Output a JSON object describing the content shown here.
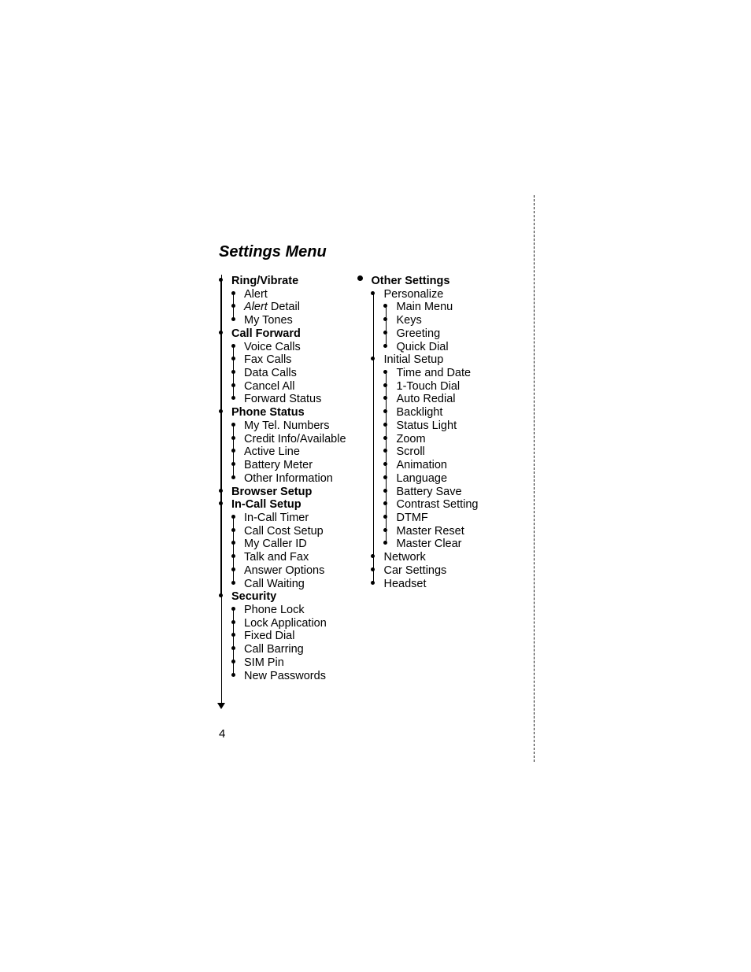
{
  "title": "Settings Menu",
  "page_number": "4",
  "col1": [
    {
      "label": "Ring/Vibrate",
      "bold": true,
      "children": [
        {
          "label": "Alert"
        },
        {
          "label_parts": [
            {
              "text": "Alert",
              "italic": true
            },
            {
              "text": " Detail"
            }
          ]
        },
        {
          "label": "My Tones"
        }
      ]
    },
    {
      "label": "Call Forward",
      "bold": true,
      "children": [
        {
          "label": "Voice Calls"
        },
        {
          "label": "Fax Calls"
        },
        {
          "label": "Data Calls"
        },
        {
          "label": "Cancel All"
        },
        {
          "label": "Forward Status"
        }
      ]
    },
    {
      "label": "Phone Status",
      "bold": true,
      "children": [
        {
          "label": "My Tel. Numbers"
        },
        {
          "label": "Credit Info/Available"
        },
        {
          "label": "Active Line"
        },
        {
          "label": "Battery Meter"
        },
        {
          "label": "Other Information"
        }
      ]
    },
    {
      "label": "Browser Setup",
      "bold": true
    },
    {
      "label": "In-Call Setup",
      "bold": true,
      "children": [
        {
          "label": "In-Call Timer"
        },
        {
          "label": "Call Cost Setup"
        },
        {
          "label": "My Caller ID"
        },
        {
          "label": "Talk and Fax"
        },
        {
          "label": "Answer Options"
        },
        {
          "label": "Call Waiting"
        }
      ]
    },
    {
      "label": "Security",
      "bold": true,
      "children": [
        {
          "label": "Phone Lock"
        },
        {
          "label": "Lock Application"
        },
        {
          "label": "Fixed Dial"
        },
        {
          "label": "Call Barring"
        },
        {
          "label": "SIM Pin"
        },
        {
          "label": "New Passwords"
        }
      ]
    }
  ],
  "col2": {
    "label": "Other Settings",
    "bold": true,
    "children": [
      {
        "label": "Personalize",
        "children": [
          {
            "label": "Main Menu"
          },
          {
            "label": "Keys"
          },
          {
            "label": "Greeting"
          },
          {
            "label": "Quick Dial"
          }
        ]
      },
      {
        "label": "Initial Setup",
        "children": [
          {
            "label": "Time and Date"
          },
          {
            "label": "1-Touch Dial"
          },
          {
            "label": "Auto Redial"
          },
          {
            "label": "Backlight"
          },
          {
            "label": "Status Light"
          },
          {
            "label": "Zoom"
          },
          {
            "label": "Scroll"
          },
          {
            "label": "Animation"
          },
          {
            "label": "Language"
          },
          {
            "label": "Battery Save"
          },
          {
            "label": "Contrast Setting"
          },
          {
            "label": "DTMF"
          },
          {
            "label": "Master Reset"
          },
          {
            "label": "Master Clear"
          }
        ]
      },
      {
        "label": "Network"
      },
      {
        "label": "Car Settings"
      },
      {
        "label": "Headset"
      }
    ]
  }
}
